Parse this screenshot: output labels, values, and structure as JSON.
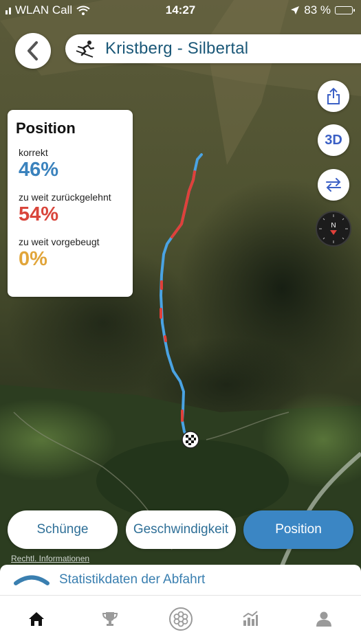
{
  "status_bar": {
    "carrier": "WLAN Call",
    "time": "14:27",
    "battery": "83 %",
    "battery_level": 0.83,
    "icons": [
      "signal-icon",
      "wifi-icon",
      "location-arrow-icon",
      "battery-icon"
    ]
  },
  "header": {
    "back_icon": "chevron-left-icon",
    "skier_icon": "skier-icon",
    "title": "Kristberg - Silbertal"
  },
  "map_controls": {
    "share_icon": "share-icon",
    "view_3d_label": "3D",
    "swap_icon": "swap-arrows-icon",
    "compass_label": "N"
  },
  "position_card": {
    "heading": "Position",
    "items": [
      {
        "label": "korrekt",
        "value": "46%",
        "color": "#3a82bd"
      },
      {
        "label": "zu weit zurückgelehnt",
        "value": "54%",
        "color": "#d9453b"
      },
      {
        "label": "zu weit vorgebeugt",
        "value": "0%",
        "color": "#e1a53a"
      }
    ]
  },
  "segments": {
    "items": [
      "Schünge",
      "Geschwindigkeit",
      "Position"
    ],
    "selected": "Position"
  },
  "legal_link": "Rechtl. Informationen",
  "stats_bar": {
    "label": "Statistikdaten der Abfahrt",
    "icon": "chevron-up-icon"
  },
  "tab_bar": {
    "items": [
      {
        "name": "home",
        "icon": "home-icon",
        "active": true
      },
      {
        "name": "trophies",
        "icon": "trophy-icon",
        "active": false
      },
      {
        "name": "center",
        "icon": "snowflake-badge-icon",
        "active": false
      },
      {
        "name": "stats",
        "icon": "chart-icon",
        "active": false
      },
      {
        "name": "profile",
        "icon": "person-icon",
        "active": false
      }
    ]
  },
  "colors": {
    "accent_blue": "#3b86c4",
    "title_blue": "#1b5878",
    "track_blue": "#4aa3e3",
    "track_red": "#e0403a"
  }
}
